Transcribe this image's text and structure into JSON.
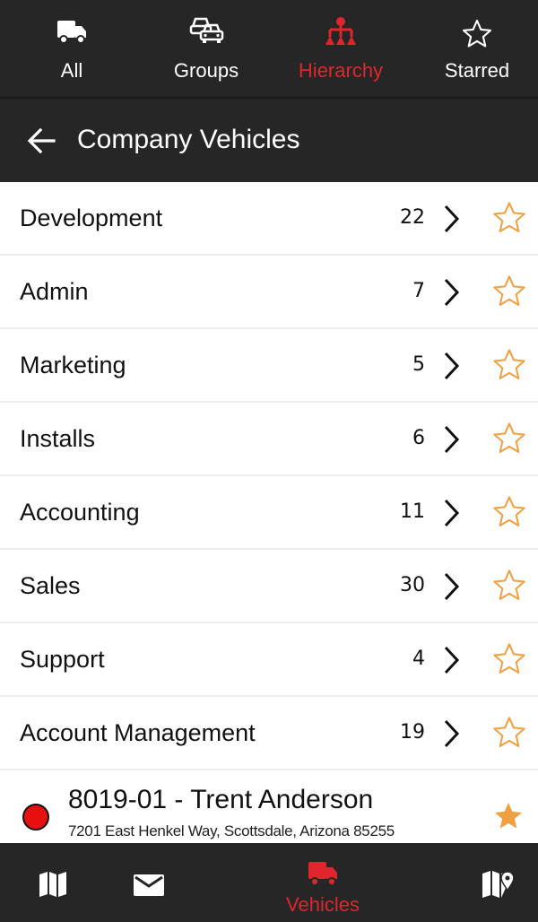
{
  "top_tabs": [
    {
      "label": "All",
      "icon": "truck-icon",
      "active": false
    },
    {
      "label": "Groups",
      "icon": "multiple-cars-icon",
      "active": false
    },
    {
      "label": "Hierarchy",
      "icon": "hierarchy-icon",
      "active": true
    },
    {
      "label": "Starred",
      "icon": "star-outline-icon",
      "active": false
    }
  ],
  "header": {
    "title": "Company Vehicles",
    "back_icon": "back-arrow-icon"
  },
  "groups": [
    {
      "name": "Development",
      "count": "22"
    },
    {
      "name": "Admin",
      "count": "7"
    },
    {
      "name": "Marketing",
      "count": "5"
    },
    {
      "name": "Installs",
      "count": "6"
    },
    {
      "name": "Accounting",
      "count": "11"
    },
    {
      "name": "Sales",
      "count": "30"
    },
    {
      "name": "Support",
      "count": "4"
    },
    {
      "name": "Account Management",
      "count": "19"
    }
  ],
  "vehicle": {
    "title": "8019-01 - Trent Anderson",
    "address": "7201 East Henkel Way, Scottsdale, Arizona 85255",
    "status_color": "#e5100f",
    "starred": true
  },
  "bottom_nav": {
    "items": [
      {
        "icon": "map-icon"
      },
      {
        "icon": "mail-icon"
      },
      {
        "icon": "truck-icon",
        "label": "Vehicles",
        "active": true
      },
      {
        "icon": "map-pin-icon"
      }
    ],
    "vehicles_label": "Vehicles"
  },
  "colors": {
    "accent": "#e0262d",
    "bar_bg": "#262626",
    "star": "#f0a040"
  }
}
